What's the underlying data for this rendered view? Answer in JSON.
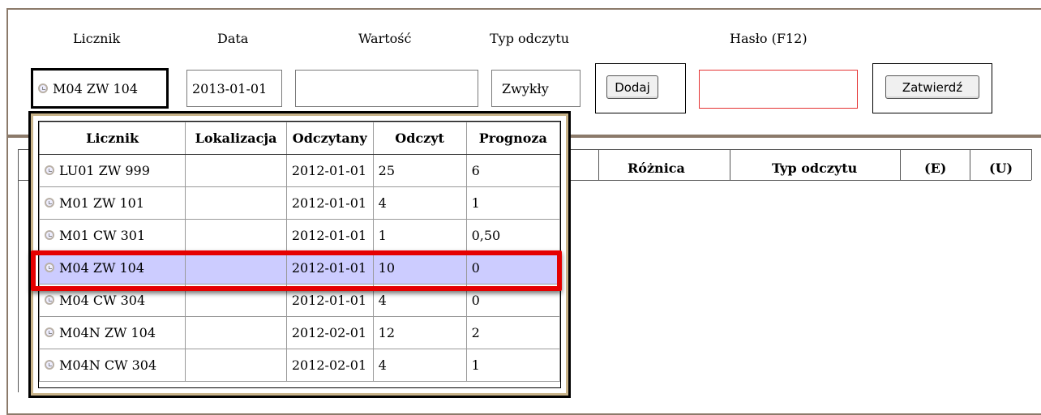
{
  "form": {
    "labels": {
      "counter": "Licznik",
      "date": "Data",
      "value": "Wartość",
      "reading_type": "Typ odczytu",
      "password": "Hasło (F12)"
    },
    "counter_value": "M04 ZW 104",
    "date_value": "2013-01-01",
    "value_value": "",
    "reading_type_value": "Zwykły",
    "password_value": "",
    "add_button": "Dodaj",
    "confirm_button": "Zatwierdź"
  },
  "lower_table": {
    "headers": [
      "Różnica",
      "Typ odczytu",
      "(E)",
      "(U)"
    ]
  },
  "dropdown": {
    "columns": [
      "Licznik",
      "Lokalizacja",
      "Odczytany",
      "Odczyt",
      "Prognoza"
    ],
    "rows": [
      {
        "counter": "LU01 ZW 999",
        "location": "",
        "read_date": "2012-01-01",
        "reading": "25",
        "forecast": "6"
      },
      {
        "counter": "M01 ZW 101",
        "location": "",
        "read_date": "2012-01-01",
        "reading": "4",
        "forecast": "1"
      },
      {
        "counter": "M01 CW 301",
        "location": "",
        "read_date": "2012-01-01",
        "reading": "1",
        "forecast": "0,50"
      },
      {
        "counter": "M04 ZW 104",
        "location": "",
        "read_date": "2012-01-01",
        "reading": "10",
        "forecast": "0"
      },
      {
        "counter": "M04 CW 304",
        "location": "",
        "read_date": "2012-01-01",
        "reading": "4",
        "forecast": "0"
      },
      {
        "counter": "M04N ZW 104",
        "location": "",
        "read_date": "2012-02-01",
        "reading": "12",
        "forecast": "2"
      },
      {
        "counter": "M04N CW 304",
        "location": "",
        "read_date": "2012-02-01",
        "reading": "4",
        "forecast": "1"
      }
    ],
    "selected_index": 3
  },
  "colors": {
    "frame_border": "#8b7a6a",
    "selected_row": "#ccccff",
    "highlight": "#e50000",
    "password_border": "#e53333"
  }
}
